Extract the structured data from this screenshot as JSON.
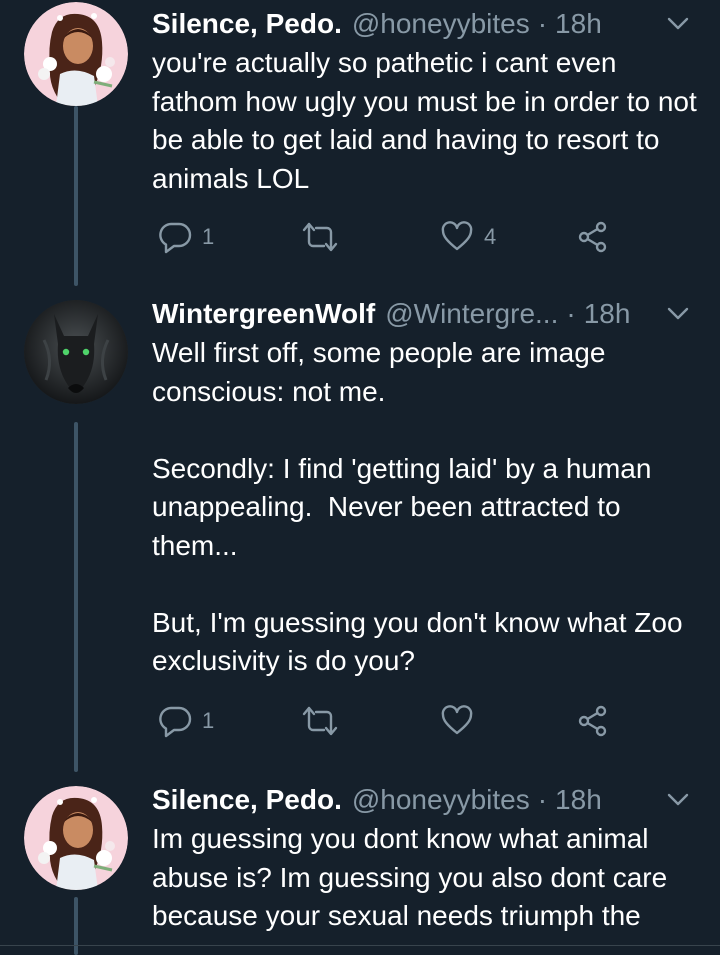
{
  "tweets": [
    {
      "display_name": "Silence, Pedo.",
      "handle": "@honeyybites",
      "separator": "·",
      "time": "18h",
      "text": "you're actually so pathetic i cant even fathom how ugly you must be in order to not be able to get laid and having to resort to animals LOL",
      "avatar": "illustrated-woman-with-flowers",
      "replies": "1",
      "retweets": "",
      "likes": "4"
    },
    {
      "display_name": "WintergreenWolf",
      "handle": "@Wintergre...",
      "separator": "·",
      "time": "18h",
      "text": "Well first off, some people are image conscious: not me.\n\nSecondly: I find 'getting laid' by a human unappealing.  Never been attracted to them...\n\nBut, I'm guessing you don't know what Zoo exclusivity is do you?",
      "avatar": "black-wolf-green-eyes",
      "replies": "1",
      "retweets": "",
      "likes": ""
    },
    {
      "display_name": "Silence, Pedo.",
      "handle": "@honeyybites",
      "separator": "·",
      "time": "18h",
      "text": "Im guessing you dont know what animal abuse is? Im guessing you also dont care because your sexual needs triumph the",
      "avatar": "illustrated-woman-with-flowers"
    }
  ],
  "icons": {
    "reply": "reply-icon",
    "retweet": "retweet-icon",
    "like": "heart-icon",
    "share": "share-icon",
    "more": "chevron-down-icon"
  },
  "colors": {
    "background": "#15202b",
    "text": "#ffffff",
    "secondary_text": "#8899a6",
    "thread_line": "#3d5466"
  }
}
